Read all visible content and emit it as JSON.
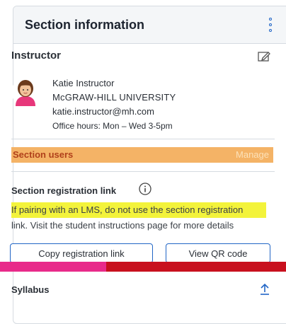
{
  "header": {
    "title": "Section information"
  },
  "instructor": {
    "title": "Instructor",
    "name": "Katie Instructor",
    "school": "McGRAW-HILL UNIVERSITY",
    "email": "katie.instructor@mh.com",
    "office_hours": "Office hours: Mon – Wed 3-5pm"
  },
  "section_users": {
    "label": "Section users",
    "action": "Manage"
  },
  "registration": {
    "title": "Section registration link",
    "text_start": "If pairing with an LMS, do not use the section registration",
    "text_end": "link. Visit the student instructions page for more details",
    "copy_button": "Copy registration link",
    "qr_button": "View QR code"
  },
  "syllabus": {
    "title": "Syllabus"
  },
  "colors": {
    "accent": "#2266c6",
    "border": "#d6dbe1",
    "header_bg": "#f4f6f8"
  }
}
